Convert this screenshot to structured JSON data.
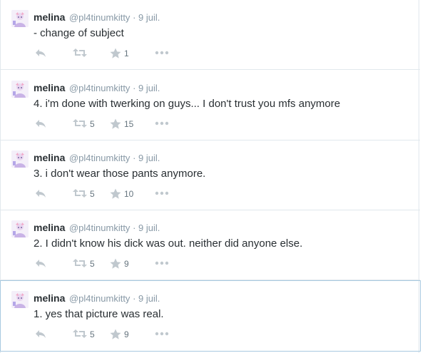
{
  "colors": {
    "accent": "#8899a6",
    "icon": "#c0c8ce",
    "divider": "#e1e8ed",
    "focus_border": "#a8c9e0"
  },
  "icons": {
    "reply": "reply-icon",
    "retweet": "retweet-icon",
    "favorite": "star-icon",
    "more": "more-dots-icon",
    "avatar": "avatar-image"
  },
  "tweets": [
    {
      "name": "melina",
      "handle": "@pl4tinumkitty",
      "sep": "·",
      "time": "9 juil.",
      "text": "- change of subject",
      "retweets": "",
      "favorites": "1"
    },
    {
      "name": "melina",
      "handle": "@pl4tinumkitty",
      "sep": "·",
      "time": "9 juil.",
      "text": "4. i'm done with twerking on guys... I don't trust you mfs anymore",
      "retweets": "5",
      "favorites": "15"
    },
    {
      "name": "melina",
      "handle": "@pl4tinumkitty",
      "sep": "·",
      "time": "9 juil.",
      "text": "3. i don't wear those pants anymore.",
      "retweets": "5",
      "favorites": "10"
    },
    {
      "name": "melina",
      "handle": "@pl4tinumkitty",
      "sep": "·",
      "time": "9 juil.",
      "text": "2. I didn't know his dick was out. neither did anyone else.",
      "retweets": "5",
      "favorites": "9"
    },
    {
      "name": "melina",
      "handle": "@pl4tinumkitty",
      "sep": "·",
      "time": "9 juil.",
      "text": "1. yes that picture was real.",
      "retweets": "5",
      "favorites": "9"
    }
  ]
}
